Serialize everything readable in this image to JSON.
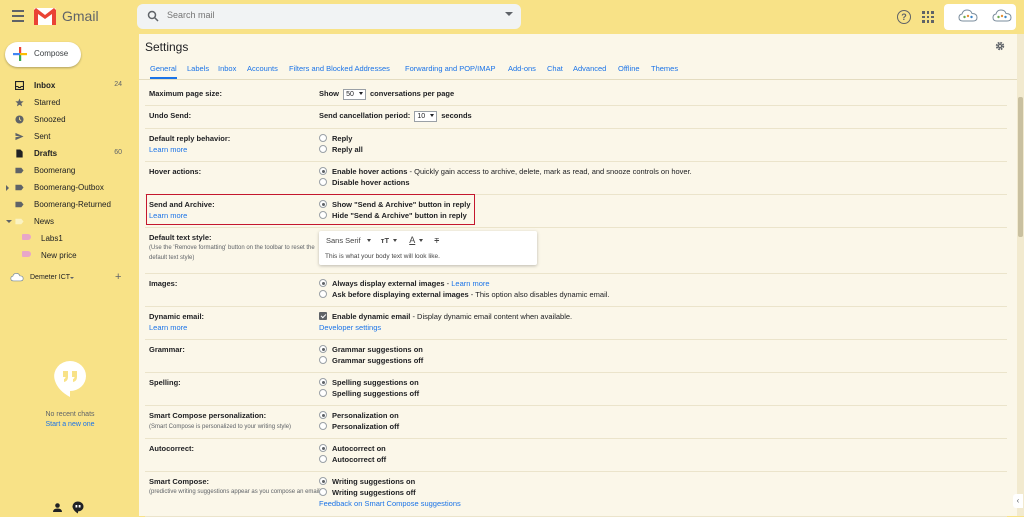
{
  "header": {
    "app_name": "Gmail",
    "search_placeholder": "Search mail"
  },
  "sidebar": {
    "compose_label": "Compose",
    "items": [
      {
        "label": "Inbox",
        "count": "24",
        "bold": true
      },
      {
        "label": "Starred",
        "count": ""
      },
      {
        "label": "Snoozed",
        "count": ""
      },
      {
        "label": "Sent",
        "count": ""
      },
      {
        "label": "Drafts",
        "count": "60",
        "bold": true
      },
      {
        "label": "Boomerang",
        "count": ""
      },
      {
        "label": "Boomerang-Outbox",
        "count": ""
      },
      {
        "label": "Boomerang-Returned",
        "count": ""
      },
      {
        "label": "News",
        "count": ""
      },
      {
        "label": "Labs1",
        "count": ""
      },
      {
        "label": "New price",
        "count": ""
      }
    ],
    "user_name": "Demeter ICT",
    "hangouts": {
      "no_chats": "No recent chats",
      "start_new": "Start a new one"
    }
  },
  "settings": {
    "title": "Settings",
    "tabs": [
      "General",
      "Labels",
      "Inbox",
      "Accounts",
      "Filters and Blocked Addresses",
      "Forwarding and POP/IMAP",
      "Add-ons",
      "Chat",
      "Advanced",
      "Offline",
      "Themes"
    ],
    "active_tab": "General",
    "rows": {
      "max_page_size": {
        "label": "Maximum page size:",
        "prefix": "Show",
        "value": "50",
        "suffix": "conversations per page"
      },
      "undo_send": {
        "label": "Undo Send:",
        "prefix": "Send cancellation period:",
        "value": "10",
        "suffix": "seconds"
      },
      "reply_behavior": {
        "label": "Default reply behavior:",
        "link": "Learn more",
        "options": [
          "Reply",
          "Reply all"
        ]
      },
      "hover_actions": {
        "label": "Hover actions:",
        "opt1_bold": "Enable hover actions",
        "opt1_rest": " - Quickly gain access to archive, delete, mark as read, and snooze controls on hover.",
        "opt2": "Disable hover actions"
      },
      "send_archive": {
        "label": "Send and Archive:",
        "link": "Learn more",
        "options": [
          "Show \"Send & Archive\" button in reply",
          "Hide \"Send & Archive\" button in reply"
        ]
      },
      "text_style": {
        "label": "Default text style:",
        "sub": "(Use the 'Remove formatting' button on the toolbar to reset the default text style)",
        "font": "Sans Serif",
        "preview": "This is what your body text will look like."
      },
      "images": {
        "label": "Images:",
        "opt1_bold": "Always display external images",
        "opt1_sep": " - ",
        "opt1_link": "Learn more",
        "opt2_bold": "Ask before displaying external images",
        "opt2_rest": " - This option also disables dynamic email."
      },
      "dynamic_email": {
        "label": "Dynamic email:",
        "link": "Learn more",
        "opt_bold": "Enable dynamic email",
        "opt_rest": " - Display dynamic email content when available.",
        "settings_link": "Developer settings"
      },
      "grammar": {
        "label": "Grammar:",
        "options": [
          "Grammar suggestions on",
          "Grammar suggestions off"
        ]
      },
      "spelling": {
        "label": "Spelling:",
        "options": [
          "Spelling suggestions on",
          "Spelling suggestions off"
        ]
      },
      "smart_compose_personalization": {
        "label": "Smart Compose personalization:",
        "sub": "(Smart Compose is personalized to your writing style)",
        "options": [
          "Personalization on",
          "Personalization off"
        ]
      },
      "autocorrect": {
        "label": "Autocorrect:",
        "options": [
          "Autocorrect on",
          "Autocorrect off"
        ]
      },
      "smart_compose": {
        "label": "Smart Compose:",
        "sub": "(predictive writing suggestions appear as you compose an email)",
        "options": [
          "Writing suggestions on",
          "Writing suggestions off"
        ],
        "link": "Feedback on Smart Compose suggestions"
      }
    }
  },
  "colors": {
    "background": "#f8e287",
    "panel": "#fbf7e9",
    "accent": "#1a73e8",
    "highlight": "#c4172e"
  }
}
